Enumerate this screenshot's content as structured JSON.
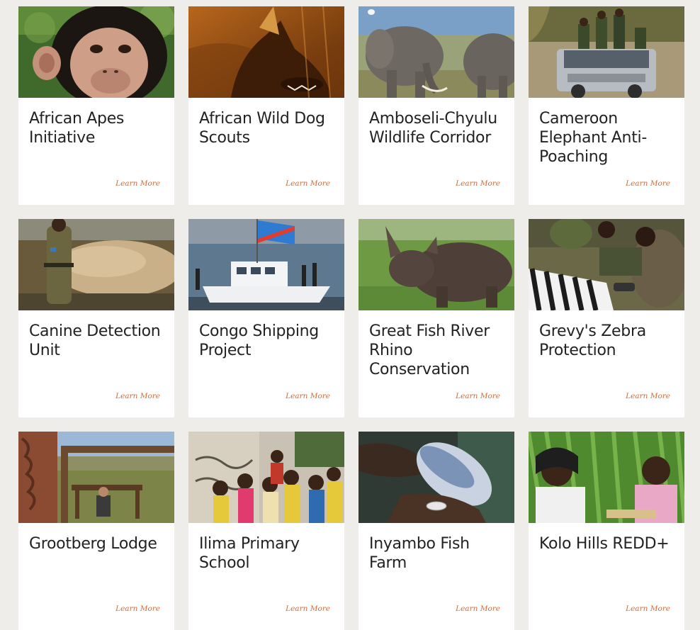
{
  "learn_more_label": "Learn More",
  "accent_color": "#d9692e",
  "projects": [
    {
      "title": "African Apes Initiative",
      "image": "chimpanzee-photo"
    },
    {
      "title": "African Wild Dog Scouts",
      "image": "wild-dog-photo"
    },
    {
      "title": "Amboseli-Chyulu Wildlife Corridor",
      "image": "elephants-photo"
    },
    {
      "title": "Cameroon Elephant Anti-Poaching",
      "image": "ranger-truck-photo"
    },
    {
      "title": "Canine Detection Unit",
      "image": "ranger-ivory-photo"
    },
    {
      "title": "Congo Shipping Project",
      "image": "boat-flag-photo"
    },
    {
      "title": "Great Fish River Rhino Conservation",
      "image": "rhino-photo"
    },
    {
      "title": "Grevy's Zebra Protection",
      "image": "zebra-collar-photo"
    },
    {
      "title": "Grootberg Lodge",
      "image": "lodge-view-photo"
    },
    {
      "title": "Ilima Primary School",
      "image": "school-children-photo"
    },
    {
      "title": "Inyambo Fish Farm",
      "image": "fish-hands-photo"
    },
    {
      "title": "Kolo Hills REDD+",
      "image": "women-crops-photo"
    }
  ]
}
